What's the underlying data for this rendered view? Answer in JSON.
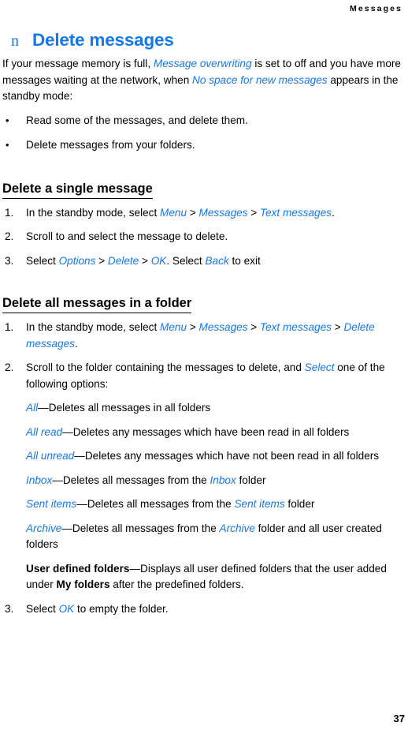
{
  "colors": {
    "accent_blue": "#1478e8",
    "text_black": "#000000",
    "background": "#ffffff"
  },
  "header": {
    "running_title": "Messages"
  },
  "chapter": {
    "bullet_glyph": "n",
    "title": "Delete messages"
  },
  "intro": {
    "part1": "If your message memory is full, ",
    "term1": "Message overwriting",
    "part2": " is set to off and you have more messages waiting at the network, when ",
    "term2": "No space for new messages",
    "part3": " appears in the standby mode:"
  },
  "intro_bullets": [
    {
      "bullet": "•",
      "text": "Read some of the messages, and delete them."
    },
    {
      "bullet": "•",
      "text": "Delete messages from your folders."
    }
  ],
  "section_single": {
    "heading": "Delete a single message",
    "steps": [
      {
        "num": "1.",
        "lead": "In the standby mode, select ",
        "t1": "Menu",
        "s1": " > ",
        "t2": "Messages",
        "s2": " > ",
        "t3": "Text messages",
        "tail": "."
      },
      {
        "num": "2.",
        "lead": "Scroll to and select the message to delete.",
        "t1": "",
        "s1": "",
        "t2": "",
        "s2": "",
        "t3": "",
        "tail": ""
      },
      {
        "num": "3.",
        "lead": "Select ",
        "t1": "Options",
        "s1": " > ",
        "t2": "Delete",
        "s2": " > ",
        "t3": "OK",
        "tail": ". Select ",
        "t4": "Back",
        "tail2": " to exit"
      }
    ]
  },
  "section_folder": {
    "heading": "Delete all messages in a folder",
    "step1": {
      "num": "1.",
      "lead": "In the standby mode, select ",
      "t1": "Menu",
      "s1": " > ",
      "t2": "Messages",
      "s2": " > ",
      "t3": "Text messages",
      "s3": " > ",
      "t4": "Delete messages",
      "tail": "."
    },
    "step2": {
      "num": "2.",
      "lead": "Scroll to the folder containing the messages to delete, and ",
      "t1": "Select",
      "tail": " one of the following options:"
    },
    "options": [
      {
        "term": "All",
        "dash": "—",
        "desc": "Deletes all messages in all folders",
        "term_style": "blue-italic"
      },
      {
        "term": "All read",
        "dash": "—",
        "desc": "Deletes any messages which have been read in all folders",
        "term_style": "blue-italic"
      },
      {
        "term": "All unread",
        "dash": "—",
        "desc": "Deletes any messages which have not been read in all folders",
        "term_style": "blue-italic"
      },
      {
        "term": "Inbox",
        "dash": "—",
        "desc_a": "Deletes all messages from the ",
        "desc_term": "Inbox",
        "desc_b": " folder",
        "term_style": "blue-italic"
      },
      {
        "term": "Sent items",
        "dash": "—",
        "desc_a": "Deletes all messages from the ",
        "desc_term": "Sent items",
        "desc_b": " folder",
        "term_style": "blue-italic"
      },
      {
        "term": "Archive",
        "dash": "—",
        "desc_a": "Deletes all messages from the ",
        "desc_term": "Archive",
        "desc_b": " folder and all user created folders",
        "term_style": "blue-italic"
      },
      {
        "term": "User defined folders",
        "dash": "—",
        "desc_a": "Displays all user defined folders that the user added under ",
        "desc_term": "My folders",
        "desc_b": " after the predefined folders.",
        "term_style": "bold-black"
      }
    ],
    "step3": {
      "num": "3.",
      "lead": "Select ",
      "t1": "OK",
      "tail": " to empty the folder."
    }
  },
  "footer": {
    "page_number": "37"
  }
}
